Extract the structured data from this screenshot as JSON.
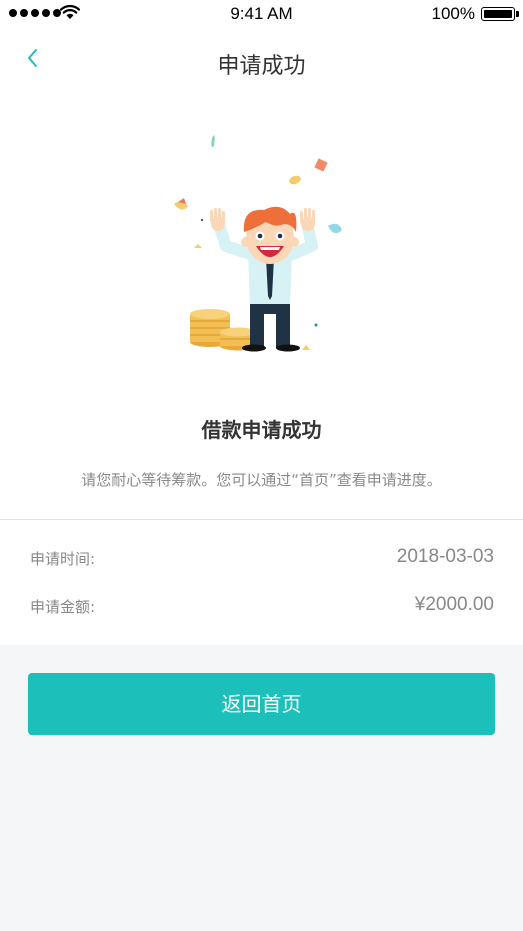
{
  "status_bar": {
    "time": "9:41 AM",
    "battery": "100%"
  },
  "nav": {
    "title": "申请成功",
    "back_icon": "chevron-left-icon"
  },
  "illustration": "celebrating-man-with-coins",
  "result": {
    "headline": "借款申请成功",
    "message": "请您耐心等待筹款。您可以通过“首页”查看申请进度。"
  },
  "details": [
    {
      "label": "申请时间:",
      "value": "2018-03-03"
    },
    {
      "label": "申请金额:",
      "value": "¥2000.00"
    }
  ],
  "actions": {
    "home_button": "返回首页"
  },
  "colors": {
    "accent": "#1dbfbb",
    "background": "#f5f6f8",
    "text_primary": "#333333",
    "text_secondary": "#888888"
  }
}
